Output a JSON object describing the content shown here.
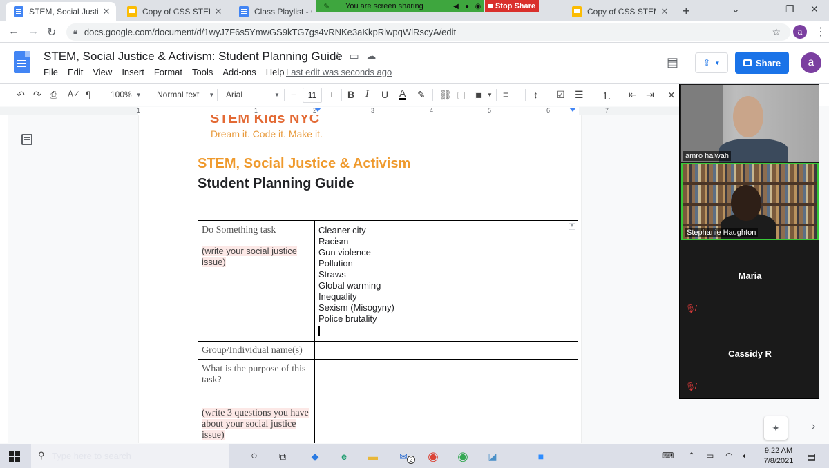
{
  "browser": {
    "tabs": [
      {
        "title": "STEM, Social Justice &",
        "icon": "docs-icon",
        "active": true
      },
      {
        "title": "Copy of CSS STEM, Sc",
        "icon": "slides-icon",
        "active": false
      },
      {
        "title": "Class Playlist - Goog",
        "icon": "docs-icon",
        "active": false
      },
      {
        "title": "Copy of CSS STEM, Sc",
        "icon": "slides-icon",
        "active": false
      }
    ],
    "url": "docs.google.com/document/d/1wyJ7F6s5YmwGS9kTG7gs4vRNKe3aKkpRlwpqWlRscyA/edit",
    "profile_initial": "a"
  },
  "screen_share": {
    "status_text": "You are screen sharing",
    "stop_label": "Stop Share",
    "color": "#3ea63e"
  },
  "docs": {
    "title": "STEM, Social Justice & Activism: Student Planning Guide",
    "menu": [
      "File",
      "Edit",
      "View",
      "Insert",
      "Format",
      "Tools",
      "Add-ons",
      "Help"
    ],
    "last_edit": "Last edit was seconds ago",
    "share_label": "Share",
    "user_initial": "a",
    "toolbar": {
      "zoom": "100%",
      "style": "Normal text",
      "font": "Arial",
      "font_size": "11"
    },
    "ruler_numbers": [
      "1",
      "1",
      "2",
      "3",
      "4",
      "5",
      "6",
      "7"
    ],
    "accent_color": "#1a73e8"
  },
  "document": {
    "brand": "STEM Kids NYC",
    "tagline": "Dream it. Code it. Make it.",
    "heading1": "STEM, Social Justice & Activism",
    "heading2": "Student Planning Guide",
    "table": {
      "row1": {
        "label": "Do Something task",
        "note": "(write your social justice issue)",
        "issues": [
          "Cleaner city",
          "Racism",
          "Gun violence",
          "Pollution",
          "Straws",
          "Global warming",
          "Inequality",
          "Sexism (Misogyny)",
          "Police brutality"
        ]
      },
      "row2": {
        "label": "Group/Individual name(s)",
        "value": ""
      },
      "row3": {
        "label": "What is the purpose of this task?",
        "note": "(write 3 questions you have about your social justice issue)",
        "value": ""
      }
    }
  },
  "zoom": {
    "participants": [
      {
        "name": "amro halwah",
        "video": true,
        "active": false
      },
      {
        "name": "Stephanie Haughton",
        "video": true,
        "active": true
      },
      {
        "name": "Maria",
        "video": false,
        "muted": true
      },
      {
        "name": "Cassidy R",
        "video": false,
        "muted": true
      }
    ]
  },
  "taskbar": {
    "search_placeholder": "Type here to search",
    "time": "9:22 AM",
    "date": "7/8/2021",
    "mail_badge": "2"
  }
}
